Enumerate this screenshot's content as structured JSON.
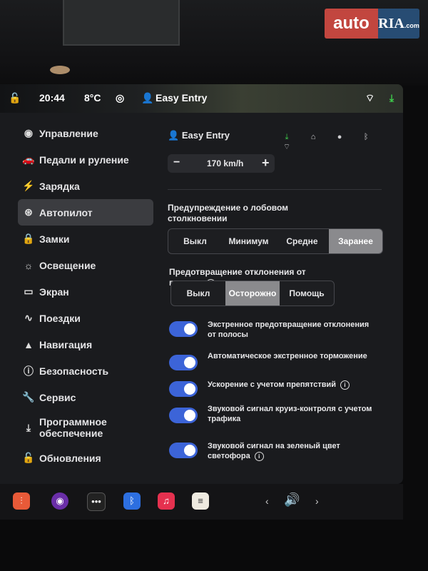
{
  "logo": {
    "left": "auto",
    "right": "RIA",
    "right_sub": ".com"
  },
  "status": {
    "time": "20:44",
    "temperature": "8°C",
    "profile": "Easy Entry"
  },
  "sidebar": {
    "items": [
      {
        "label": "Управление",
        "icon": "toggle-icon"
      },
      {
        "label": "Педали и руление",
        "icon": "car-icon"
      },
      {
        "label": "Зарядка",
        "icon": "bolt-icon"
      },
      {
        "label": "Автопилот",
        "icon": "steering-wheel-icon",
        "active": true
      },
      {
        "label": "Замки",
        "icon": "lock-icon"
      },
      {
        "label": "Освещение",
        "icon": "sun-icon"
      },
      {
        "label": "Экран",
        "icon": "display-icon"
      },
      {
        "label": "Поездки",
        "icon": "trips-icon"
      },
      {
        "label": "Навигация",
        "icon": "navigation-icon"
      },
      {
        "label": "Безопасность",
        "icon": "safety-icon"
      },
      {
        "label": "Сервис",
        "icon": "wrench-icon"
      },
      {
        "label": "Программное обеспечение",
        "icon": "download-icon"
      },
      {
        "label": "Обновления",
        "icon": "bag-icon"
      }
    ]
  },
  "content": {
    "profile": "Easy Entry",
    "speed": {
      "value": "170 km/h",
      "minus": "−",
      "plus": "+"
    },
    "collision": {
      "title": "Предупреждение о лобовом столкновении",
      "options": [
        "Выкл",
        "Минимум",
        "Средне",
        "Заранее"
      ],
      "selected": "Заранее"
    },
    "lane": {
      "title": "Предотвращение отклонения от полосы",
      "options": [
        "Выкл",
        "Осторожно",
        "Помощь"
      ],
      "selected": "Осторожно"
    },
    "toggles": [
      {
        "label": "Экстренное предотвращение отклонения от полосы",
        "on": true
      },
      {
        "label": "Автоматическое экстренное торможение",
        "on": true
      },
      {
        "label": "Ускорение с учетом препятствий",
        "on": true
      },
      {
        "label": "Звуковой сигнал круиз-контроля с учетом трафика",
        "on": true
      },
      {
        "label": "Звуковой сигнал на зеленый цвет светофора",
        "on": true
      }
    ]
  },
  "colors": {
    "toggle_on": "#3c64d8",
    "segment_selected": "#8a8a8d",
    "download_green": "#3fd14d"
  }
}
